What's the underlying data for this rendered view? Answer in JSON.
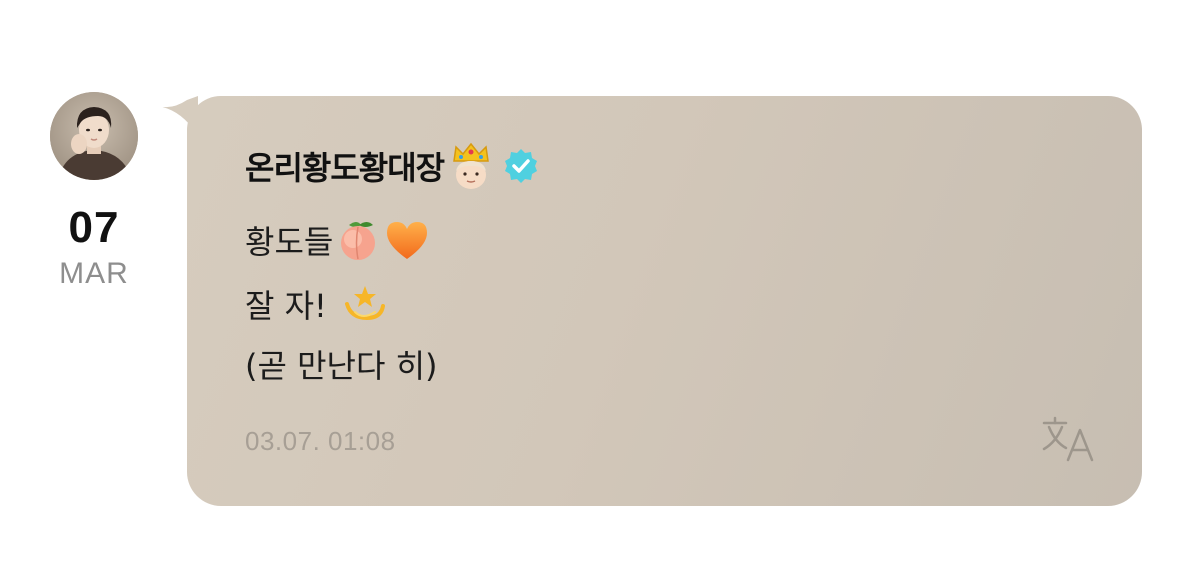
{
  "post": {
    "date_day": "07",
    "date_month": "MAR",
    "sender_name": "온리황도황대장",
    "lines": {
      "line1_text": "황도들",
      "line2_text": "잘 자!",
      "line3_text": "(곧 만난다 히)"
    },
    "timestamp": "03.07. 01:08"
  },
  "icons": {
    "avatar": "profile-photo",
    "crown": "crowned-person-emoji",
    "verified": "verified-badge-icon",
    "peach": "peach-emoji",
    "heart": "orange-heart-emoji",
    "dizzy": "dizzy-star-emoji",
    "translate": "translate-icon"
  },
  "colors": {
    "bubble": "#d2c7b9",
    "verified": "#4fd0e0",
    "timestamp": "#a79f95",
    "month": "#8e8e8e"
  }
}
